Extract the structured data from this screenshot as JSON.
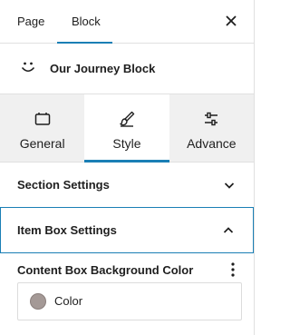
{
  "top_tabs": {
    "page_label": "Page",
    "block_label": "Block",
    "active": "Block"
  },
  "block_header": {
    "title": "Our Journey Block",
    "icon": "smile-icon"
  },
  "style_tabs": [
    {
      "label": "General",
      "icon": "panel-icon"
    },
    {
      "label": "Style",
      "icon": "brush-icon"
    },
    {
      "label": "Advance",
      "icon": "sliders-icon"
    }
  ],
  "active_style_tab": "Style",
  "sections": [
    {
      "title": "Section Settings",
      "expanded": false
    },
    {
      "title": "Item Box Settings",
      "expanded": true
    }
  ],
  "color_control": {
    "label": "Content Box Background Color",
    "button_label": "Color",
    "swatch_color": "#a49996"
  },
  "colors": {
    "accent": "#1a7fb5",
    "tab_bg": "#f0f0f0",
    "border": "#e0e0e0"
  }
}
